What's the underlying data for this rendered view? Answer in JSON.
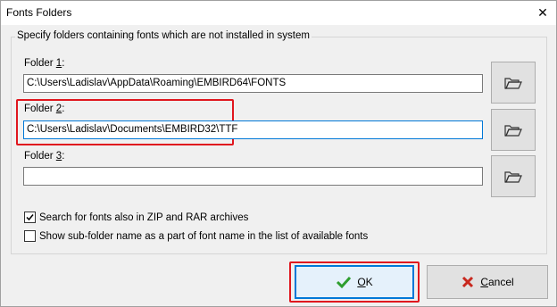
{
  "window": {
    "title": "Fonts Folders",
    "close_glyph": "✕"
  },
  "group": {
    "label": "Specify folders containing fonts which are not installed in system"
  },
  "folders": [
    {
      "label_prefix": "Folder ",
      "label_key": "1",
      "label_suffix": ":",
      "value": "C:\\Users\\Ladislav\\AppData\\Roaming\\EMBIRD64\\FONTS"
    },
    {
      "label_prefix": "Folder ",
      "label_key": "2",
      "label_suffix": ":",
      "value": "C:\\Users\\Ladislav\\Documents\\EMBIRD32\\TTF"
    },
    {
      "label_prefix": "Folder ",
      "label_key": "3",
      "label_suffix": ":",
      "value": ""
    }
  ],
  "options": [
    {
      "label": "Search for fonts also in ZIP and RAR archives",
      "checked": true
    },
    {
      "label": "Show sub-folder name as a part of font name in the list of available fonts",
      "checked": false
    }
  ],
  "buttons": {
    "ok_key": "O",
    "ok_rest": "K",
    "cancel_key": "C",
    "cancel_rest": "ancel"
  },
  "colors": {
    "highlight": "#e0161e",
    "focus": "#0078d7",
    "ok_check": "#2e9e2e",
    "cancel_x": "#c8281e"
  }
}
